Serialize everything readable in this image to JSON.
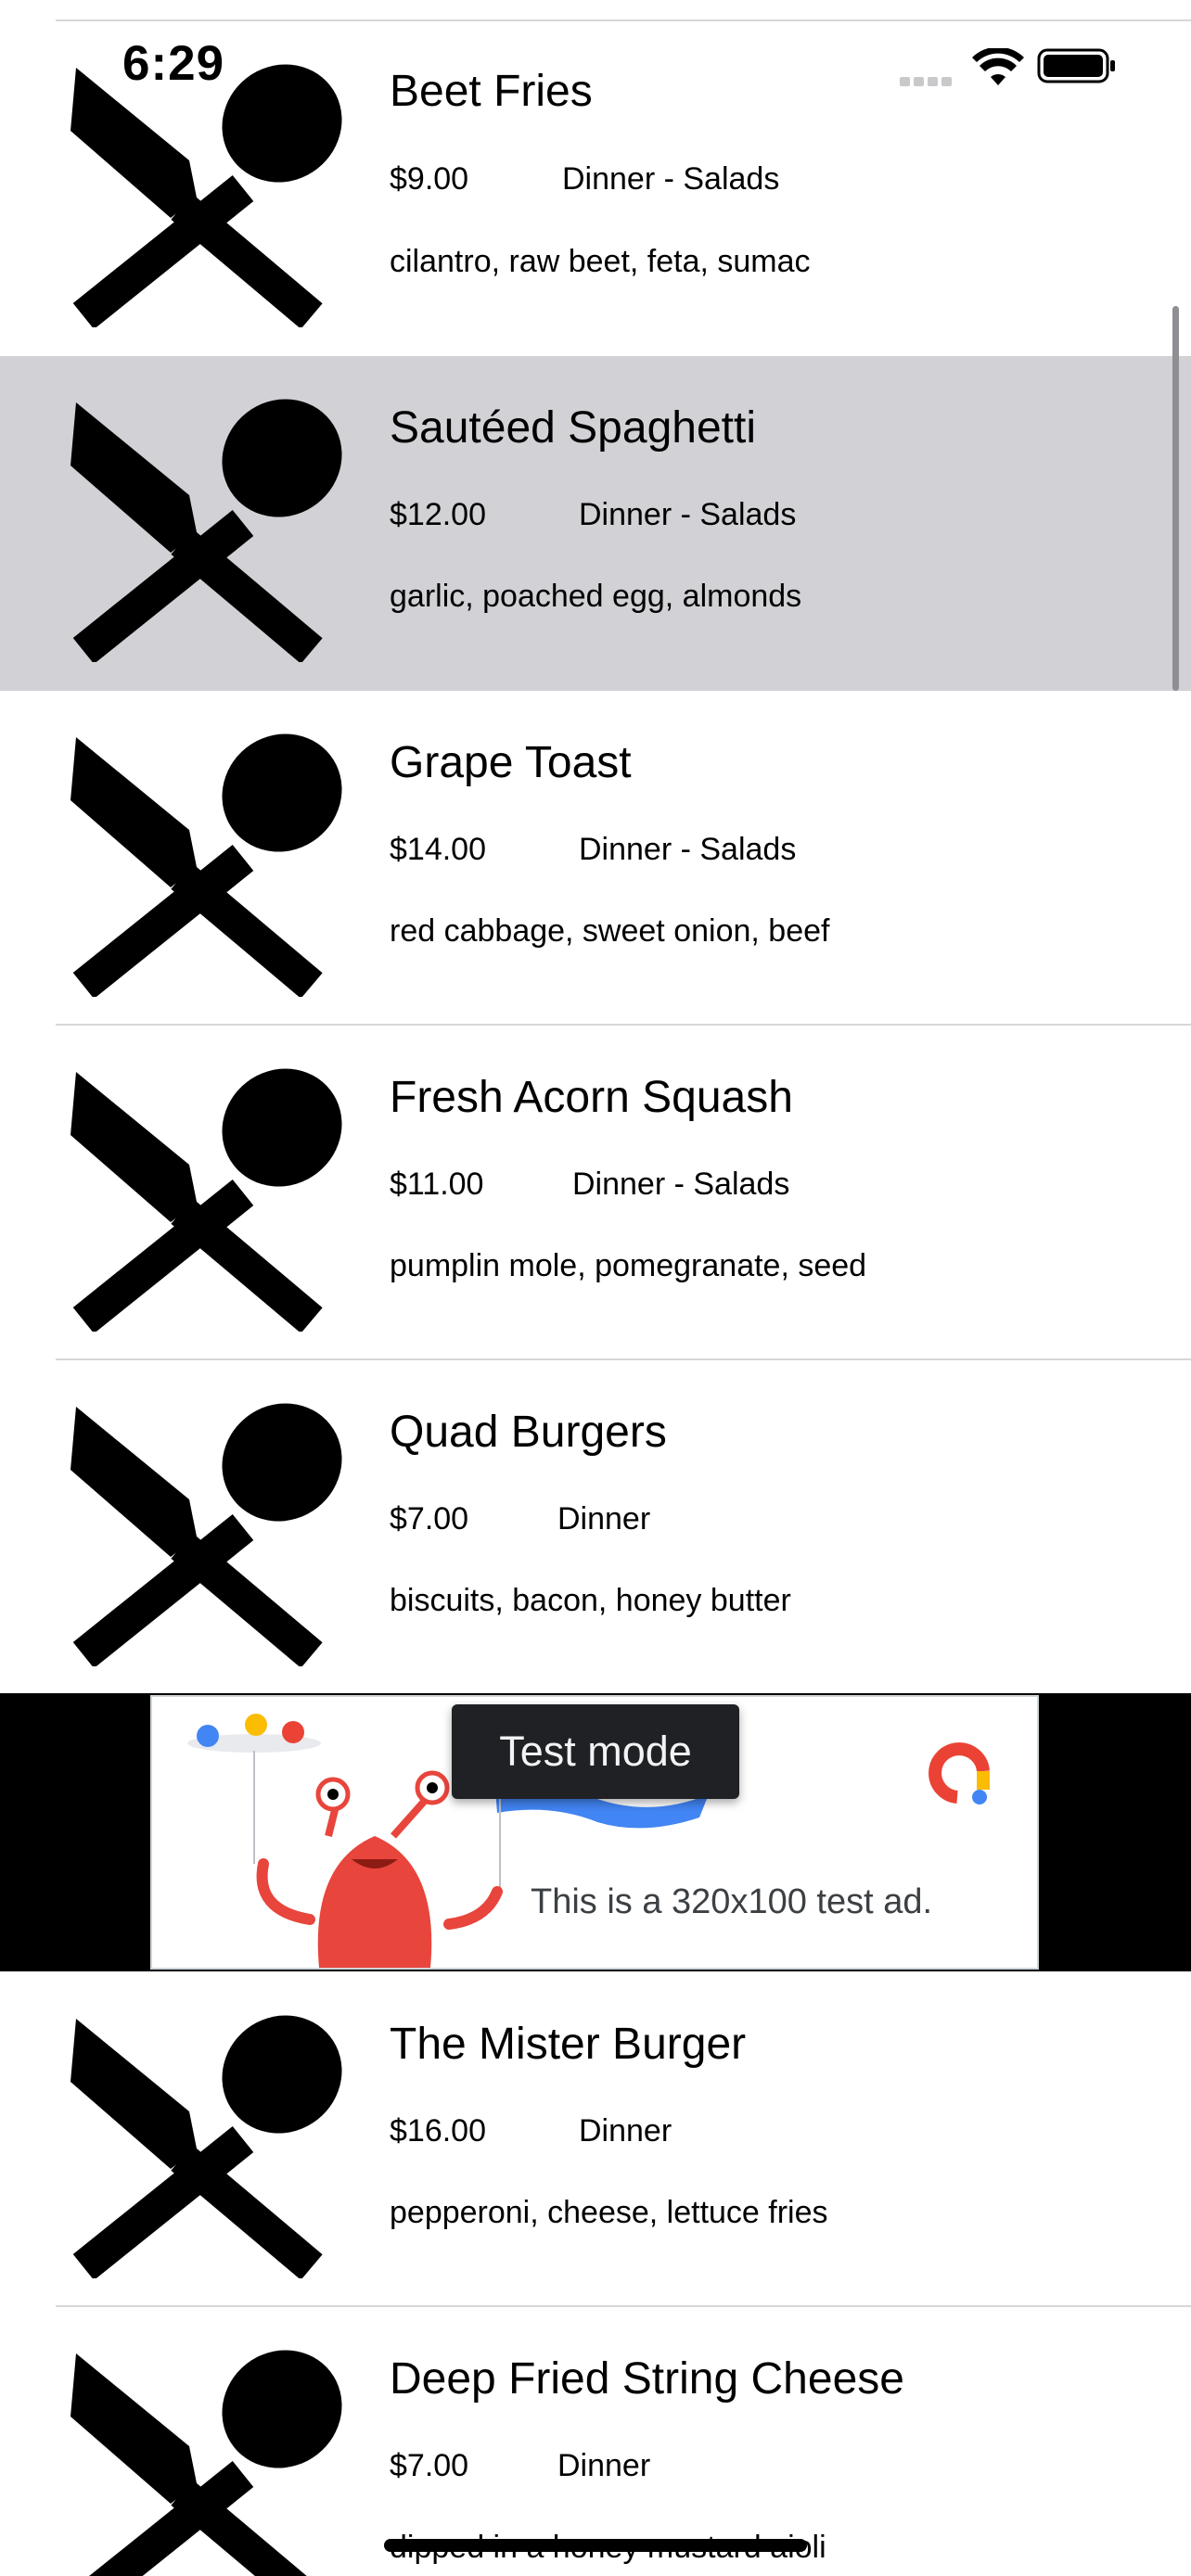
{
  "status_bar": {
    "time": "6:29"
  },
  "menu_items": [
    {
      "name": "Beet Fries",
      "price": "$9.00",
      "category": "Dinner - Salads",
      "description": "cilantro, raw beet, feta, sumac",
      "icon": "fork-knife-spoon-icon"
    },
    {
      "name": "Sautéed Spaghetti",
      "price": "$12.00",
      "category": "Dinner - Salads",
      "description": "garlic, poached egg, almonds",
      "icon": "fork-knife-spoon-icon",
      "selected": true
    },
    {
      "name": "Grape Toast",
      "price": "$14.00",
      "category": "Dinner - Salads",
      "description": "red cabbage, sweet onion, beef",
      "icon": "fork-knife-spoon-icon"
    },
    {
      "name": "Fresh Acorn Squash",
      "price": "$11.00",
      "category": "Dinner - Salads",
      "description": "pumplin mole, pomegranate, seed",
      "icon": "fork-knife-spoon-icon"
    },
    {
      "name": "Quad Burgers",
      "price": "$7.00",
      "category": "Dinner",
      "description": "biscuits, bacon, honey butter",
      "icon": "fork-knife-spoon-icon"
    },
    {
      "name": "The Mister Burger",
      "price": "$16.00",
      "category": "Dinner",
      "description": "pepperoni, cheese, lettuce fries",
      "icon": "fork-knife-spoon-icon"
    },
    {
      "name": "Deep Fried String Cheese",
      "price": "$7.00",
      "category": "Dinner",
      "description": "dipped in a honey mustard aioli",
      "icon": "fork-knife-spoon-icon"
    }
  ],
  "ad": {
    "badge": "Test mode",
    "text": "This is a 320x100 test ad.",
    "colors": {
      "mascot": "#e8453c",
      "blue": "#4285f4",
      "yellow": "#fbbc04",
      "red": "#ea4335"
    }
  },
  "colors": {
    "selected_row": "#d1d1d6",
    "separator": "#d7d7da",
    "ad_background": "#000000"
  }
}
